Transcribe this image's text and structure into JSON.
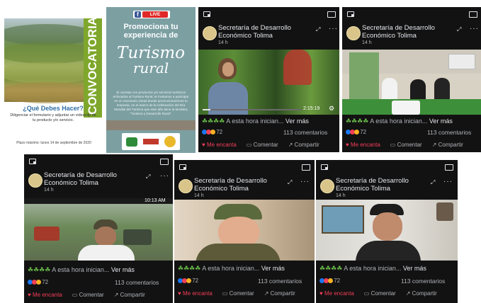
{
  "poster1": {
    "vertical_title": "CONVOCATORIA",
    "question": "¿Qué Debes Hacer?",
    "instructions": "Diligenciar el formulario y adjuntar un videoclip de tu producto y/o servicio.",
    "deadline": "Plazo máximo: lunes 14 de septiembre de 2020"
  },
  "poster2": {
    "fb_live_label": "LIVE",
    "heading": "Promociona tu experiencia de",
    "script_word_1": "Turismo",
    "script_word_2": "rural",
    "body": "Si cuentas con productos y/o servicios turísticos enfocados al Turismo Rural, te invitamos a participar en un escenario virtual donde promocionaremos tu empresa, en el marco de la celebración del Día Mundial del Turismo que este año tiene la temática \"Turismo y Desarrollo Rural\"."
  },
  "post": {
    "author": "Secretaría de Desarrollo Económico Tolima",
    "author_line1": "Secretaría de Desarrollo",
    "author_line2": "Económico Tolima",
    "time": "14 h",
    "caption": "A esta hora inician...",
    "see_more": "Ver más",
    "reaction_count": "72",
    "comments": "113 comentarios",
    "love_label": "Me encanta",
    "comment_label": "Comentar",
    "share_label": "Compartir"
  },
  "video1": {
    "elapsed": "2:15:19",
    "progress": 0.08
  },
  "video4": {
    "overlay_time": "10:13 AM"
  },
  "colors": {
    "dark_bg": "#121212",
    "love": "#f33e58",
    "like": "#1877f2",
    "text": "#e4e6eb",
    "muted": "#b0b3b8"
  },
  "icons": [
    "minimize-icon",
    "cast-icon",
    "expand-icon",
    "more-dots-icon",
    "heart-icon",
    "comment-icon",
    "share-icon",
    "settings-gear-icon",
    "clover-icon"
  ]
}
